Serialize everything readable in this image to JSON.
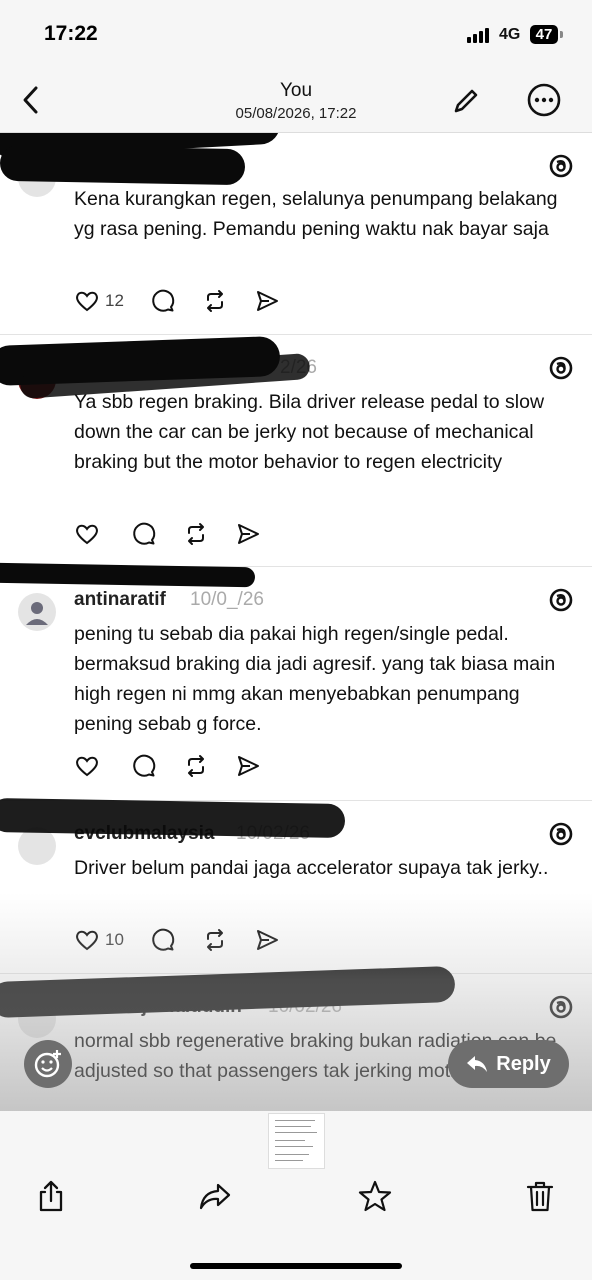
{
  "status_bar": {
    "time": "17:22",
    "network": "4G",
    "battery": "47"
  },
  "header": {
    "title": "You",
    "subtitle": "05/08/2026, 17:22"
  },
  "posts": [
    {
      "handle": "",
      "date": "",
      "text": "Kena kurangkan regen, selalunya penumpang belakang yg rasa pening. Pemandu pening waktu nak bayar saja",
      "likes": "12"
    },
    {
      "handle": "",
      "date": "2/26",
      "text": "Ya sbb regen braking. Bila driver release pedal to slow down the car can be jerky not because of mechanical braking but the motor behavior to regen electricity",
      "likes": ""
    },
    {
      "handle": "antinaratif",
      "date": "10/0_/26",
      "text": "pening tu sebab dia pakai high regen/single pedal. bermaksud braking dia jadi agresif. yang tak biasa main high regen ni mmg akan menyebabkan penumpang pening sebab g force.",
      "likes": ""
    },
    {
      "handle": "evclubmalaysia",
      "date": "10/02/26",
      "text": "Driver belum pandai jaga accelerator supaya tak jerky..",
      "likes": "10"
    },
    {
      "handle": "naadirajamaluddin",
      "date": "10/02/26",
      "text": "normal sbb regenerative braking bukan radiation can be adjusted so that passengers tak jerking motion tu.",
      "likes": ""
    }
  ],
  "reply_button": {
    "label": "Reply"
  },
  "toolbar": {
    "share": "share-icon",
    "forward": "forward-icon",
    "favorite": "star-icon",
    "delete": "trash-icon"
  }
}
